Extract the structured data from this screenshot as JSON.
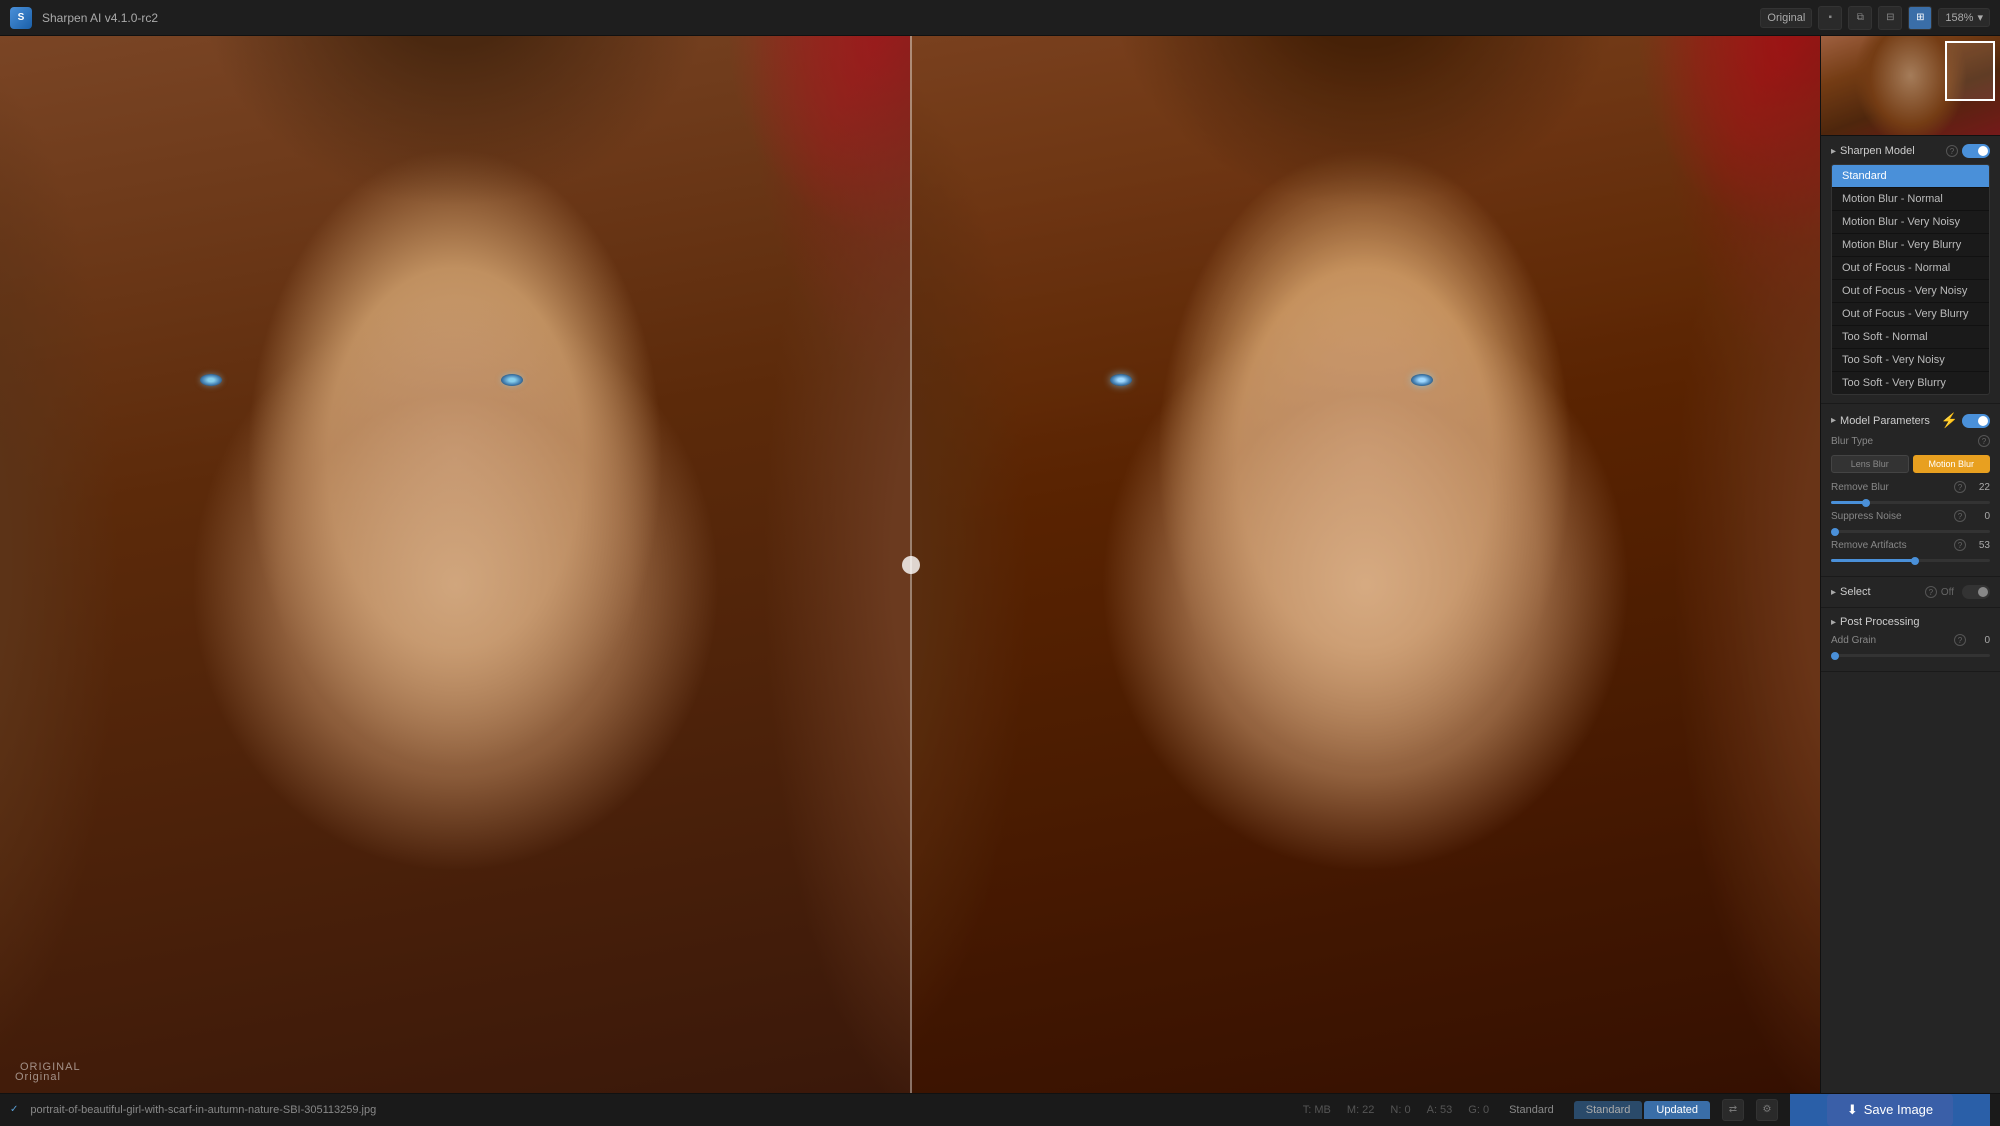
{
  "app": {
    "title": "Sharpen AI v4.1.0-rc2",
    "logo": "S"
  },
  "topbar": {
    "original_btn": "Original",
    "zoom_level": "158%",
    "view_modes": [
      "single",
      "split-v",
      "split-h",
      "grid"
    ]
  },
  "model": {
    "section_label": "Sharpen Model",
    "items": [
      {
        "id": "standard",
        "label": "Standard",
        "selected": true
      },
      {
        "id": "motion-blur-normal",
        "label": "Motion Blur - Normal",
        "selected": false
      },
      {
        "id": "motion-blur-very-noisy",
        "label": "Motion Blur - Very Noisy",
        "selected": false
      },
      {
        "id": "motion-blur-very-blurry",
        "label": "Motion Blur - Very Blurry",
        "selected": false
      },
      {
        "id": "out-of-focus-normal",
        "label": "Out of Focus - Normal",
        "selected": false
      },
      {
        "id": "out-of-focus-very-noisy",
        "label": "Out of Focus - Very Noisy",
        "selected": false
      },
      {
        "id": "out-of-focus-very-blurry",
        "label": "Out of Focus - Very Blurry",
        "selected": false
      },
      {
        "id": "too-soft-normal",
        "label": "Too Soft - Normal",
        "selected": false
      },
      {
        "id": "too-soft-very-noisy",
        "label": "Too Soft - Very Noisy",
        "selected": false
      },
      {
        "id": "too-soft-very-blurry",
        "label": "Too Soft - Very Blurry",
        "selected": false
      }
    ]
  },
  "parameters": {
    "section_label": "Model Parameters",
    "blur_type": {
      "label": "Blur Type",
      "options": [
        "Lens Blur",
        "Motion Blur"
      ],
      "active": "Motion Blur"
    },
    "remove_blur": {
      "label": "Remove Blur",
      "value": 22,
      "min": 0,
      "max": 100,
      "percent": 22
    },
    "suppress_noise": {
      "label": "Suppress Noise",
      "value": 0,
      "min": 0,
      "max": 100,
      "percent": 0
    },
    "remove_artifacts": {
      "label": "Remove Artifacts",
      "value": 53,
      "min": 0,
      "max": 100,
      "percent": 53
    }
  },
  "select": {
    "label": "Select",
    "status": "Off"
  },
  "post_processing": {
    "label": "Post Processing",
    "add_grain": {
      "label": "Add Grain",
      "value": 0,
      "min": 0,
      "max": 100,
      "percent": 0
    }
  },
  "bottom": {
    "file_path": "portrait-of-beautiful-girl-with-scarf-in-autumn-nature-SBI-305113259.jpg",
    "stats": {
      "t": "T: MB",
      "m": "M: 22",
      "n": "N: 0",
      "a": "A: 53",
      "g": "G: 0"
    },
    "model_name": "Standard",
    "tabs": {
      "standard": "Standard",
      "updated": "Updated"
    }
  },
  "image": {
    "label_left": "Original",
    "label_right": ""
  },
  "save_btn": "Save Image"
}
